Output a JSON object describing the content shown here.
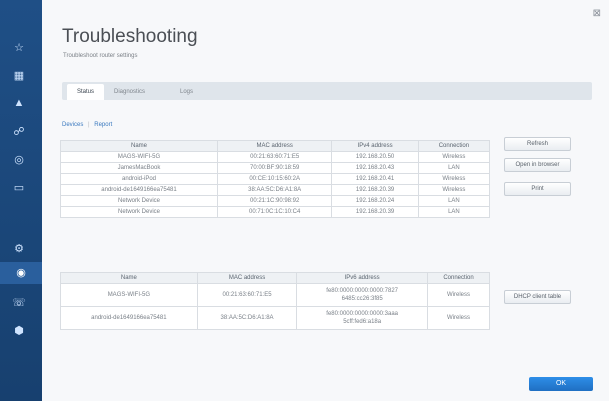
{
  "page": {
    "title": "Troubleshooting",
    "subtitle": "Troubleshoot router settings"
  },
  "tabs": [
    {
      "label": "Status"
    },
    {
      "label": "Diagnostics"
    },
    {
      "label": "Logs"
    }
  ],
  "filter": {
    "devices": "Devices",
    "separator": "|",
    "report": "Report"
  },
  "table1": {
    "headers": [
      "Name",
      "MAC address",
      "IPv4 address",
      "Connection"
    ],
    "rows": [
      [
        "MAGS-WIFI-5G",
        "00:21:63:60:71:E5",
        "192.168.20.50",
        "Wireless"
      ],
      [
        "JamesMacBook",
        "70:00:BF:90:18:59",
        "192.168.20.43",
        "LAN"
      ],
      [
        "android-iPod",
        "00:CE:10:15:60:2A",
        "192.168.20.41",
        "Wireless"
      ],
      [
        "android-de1649166ea75481",
        "38:AA:5C:D6:A1:8A",
        "192.168.20.39",
        "Wireless"
      ],
      [
        "Network Device",
        "00:21:1C:90:98:92",
        "192.168.20.24",
        "LAN"
      ],
      [
        "Network Device",
        "00:71:0C:1C:10:C4",
        "192.168.20.39",
        "LAN"
      ]
    ]
  },
  "table2": {
    "headers": [
      "Name",
      "MAC address",
      "IPv6 address",
      "Connection"
    ],
    "rows": [
      [
        "MAGS-WIFI-5G",
        "00:21:63:60:71:E5",
        [
          "fe80:0000:0000:0000:7827",
          "6485:cc26:3f85"
        ],
        "Wireless"
      ],
      [
        "android-de1649166ea75481",
        "38:AA:5C:D6:A1:8A",
        [
          "fe80:0000:0000:0000:3aaa",
          "5cff:fed6:a18a"
        ],
        "Wireless"
      ]
    ]
  },
  "buttons": {
    "refresh": "Refresh",
    "open_browser": "Open in browser",
    "print": "Print",
    "dhcp": "DHCP client table",
    "ok": "OK"
  },
  "icons": {
    "close": "⊠",
    "sidebar": [
      "☆",
      "▦",
      "▲",
      "☍",
      "◎",
      "▭",
      "⚙",
      "◉",
      "☏",
      "⬢"
    ]
  }
}
